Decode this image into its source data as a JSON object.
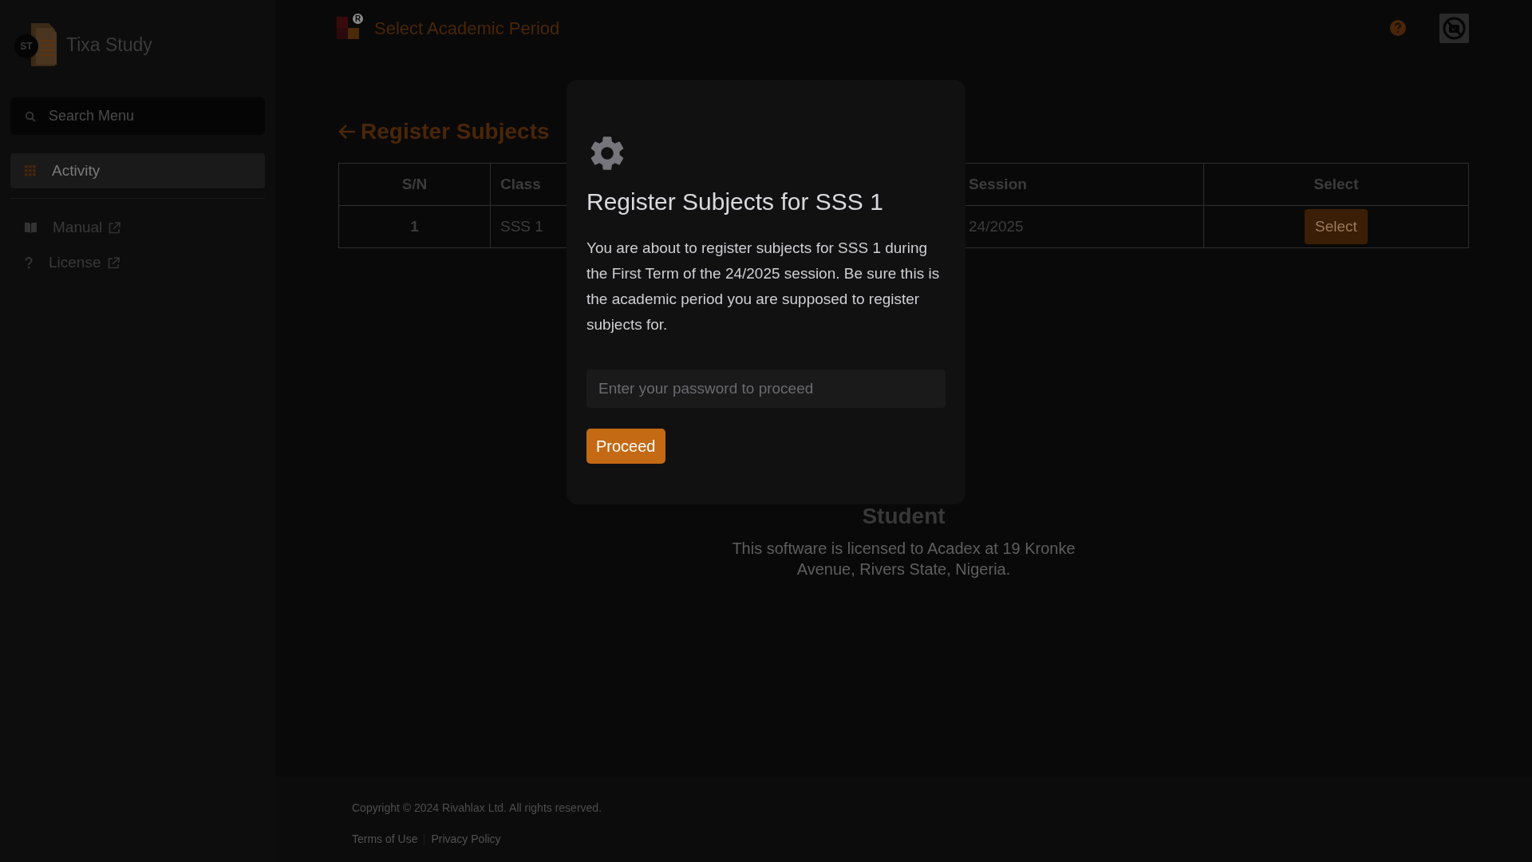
{
  "sidebar": {
    "brand": "Tixa Study",
    "logo_text": "ST",
    "search": {
      "placeholder": "Search Menu"
    },
    "items": [
      {
        "label": "Activity",
        "kind": "grid",
        "selected": true,
        "external": false
      },
      {
        "label": "Manual",
        "kind": "book",
        "selected": false,
        "external": true
      },
      {
        "label": "License",
        "kind": "question",
        "selected": false,
        "external": true
      }
    ]
  },
  "header": {
    "badge": "R",
    "title": "Select Academic Period"
  },
  "page": {
    "title": "Register Subjects",
    "table": {
      "columns": [
        "S/N",
        "Class",
        "Session",
        "Select"
      ],
      "rows": [
        {
          "sn": "1",
          "class": "SSS 1",
          "session": "24/2025",
          "action": "Select"
        }
      ]
    },
    "role": "Student",
    "license": "This software is licensed to Acadex at 19 Kronke Avenue, Rivers State, Nigeria."
  },
  "footer": {
    "copyright": "Copyright © 2024 Rivahlax Ltd. All rights reserved.",
    "links": [
      "Terms of Use",
      "Privacy Policy"
    ]
  },
  "modal": {
    "title": "Register Subjects for SSS 1",
    "message": "You are about to register subjects for SSS 1 during the First Term of the 24/2025 session. Be sure this is the academic period you are supposed to register subjects for.",
    "password": {
      "placeholder": "Enter your password to proceed"
    },
    "button": "Proceed"
  }
}
